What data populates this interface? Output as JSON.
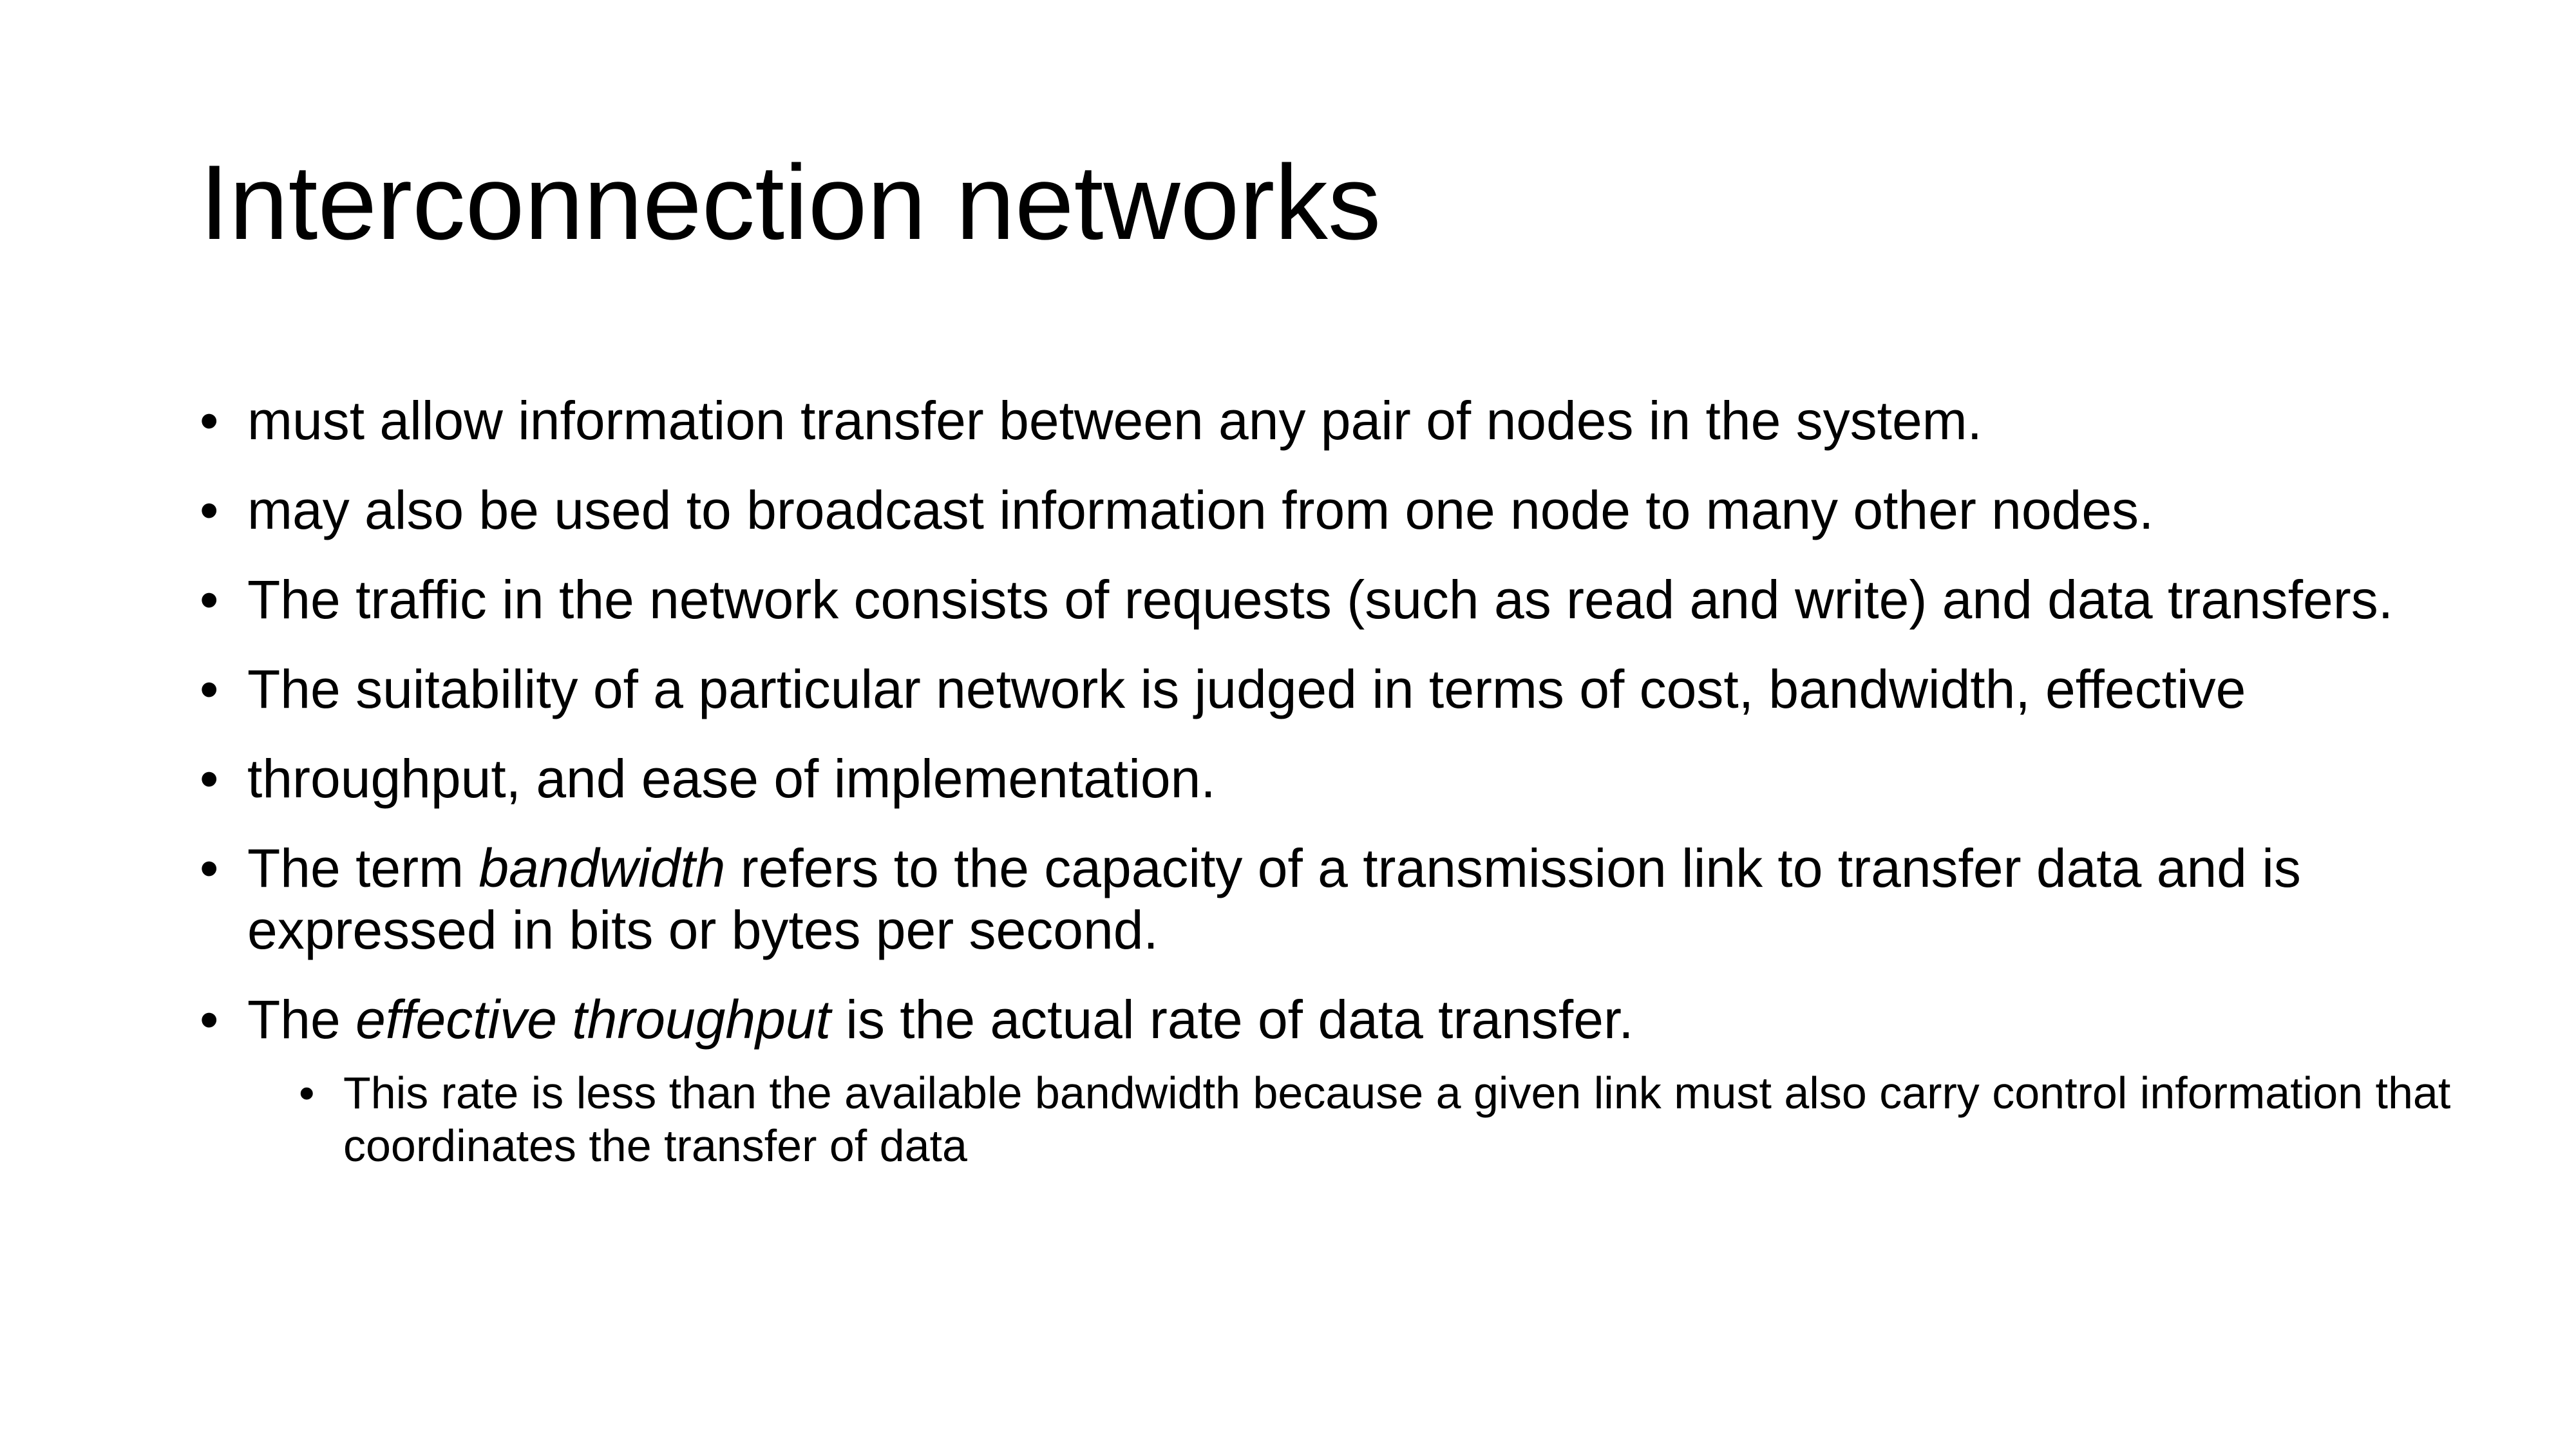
{
  "slide": {
    "title": "Interconnection networks",
    "bullet_symbol": "•",
    "bullets": [
      {
        "text": "must allow information transfer between any pair of nodes in the system."
      },
      {
        "text": "may also be used to broadcast information from one node to many other nodes."
      },
      {
        "text": "The traffic in the network consists of requests (such as read and write) and data transfers."
      },
      {
        "text": "The suitability of a particular network is judged in terms of cost, bandwidth, effective"
      },
      {
        "text": "throughput, and ease of implementation."
      },
      {
        "pre": "The term ",
        "em": "bandwidth",
        "post": " refers to the capacity of a transmission link to transfer data and is expressed in bits or bytes per second."
      },
      {
        "pre": "The ",
        "em": "effective throughput",
        "post": " is the actual rate of data transfer."
      }
    ],
    "sub_bullets": [
      {
        "text": "This rate is less than the available bandwidth because a given link must also carry control information that coordinates the transfer of data"
      }
    ]
  }
}
